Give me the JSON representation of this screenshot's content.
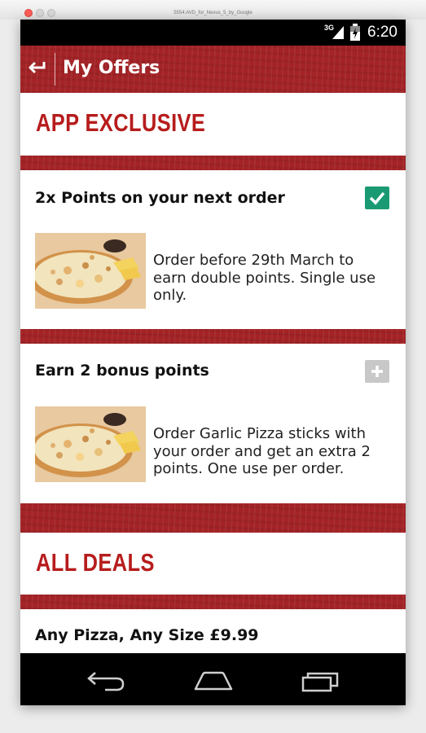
{
  "window": {
    "title": "5554:AVD_for_Nexus_5_by_Google"
  },
  "status_bar": {
    "network": "3G",
    "time": "6:20"
  },
  "app_bar": {
    "title": "My Offers"
  },
  "sections": {
    "app_exclusive": "APP EXCLUSIVE",
    "all_deals": "ALL DEALS"
  },
  "offers": [
    {
      "title": "2x Points on your next order",
      "description": "Order before 29th March to earn double points. Single use only.",
      "state": "selected",
      "action_icon": "check-icon"
    },
    {
      "title": "Earn 2 bonus points",
      "description": "Order Garlic Pizza sticks with your order and get an extra 2 points. One use per order.",
      "state": "unselected",
      "action_icon": "plus-icon"
    }
  ],
  "deals": [
    {
      "title": "Any Pizza, Any Size £9.99"
    }
  ],
  "nav": [
    "back-icon",
    "home-icon",
    "recent-apps-icon"
  ],
  "colors": {
    "brand_red": "#a32326",
    "heading_red": "#b71c1c",
    "selected_green": "#1a9a72"
  }
}
